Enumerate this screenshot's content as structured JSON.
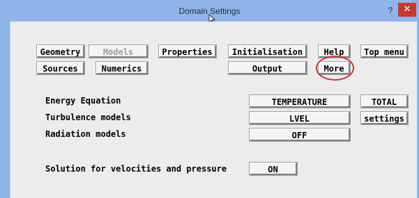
{
  "window": {
    "title": "Domain Settings",
    "help_glyph": "?",
    "close_glyph": "✕"
  },
  "toolbar": {
    "geometry": "Geometry",
    "models": "Models",
    "properties": "Properties",
    "initialisation": "Initialisation",
    "help": "Help",
    "top_menu": "Top menu",
    "sources": "Sources",
    "numerics": "Numerics",
    "output": "Output",
    "more": "More"
  },
  "settings": {
    "energy_label": "Energy Equation",
    "energy_value": "TEMPERATURE",
    "energy_total": "TOTAL",
    "turbulence_label": "Turbulence models",
    "turbulence_value": "LVEL",
    "turbulence_settings": "settings",
    "radiation_label": "Radiation models",
    "radiation_value": "OFF",
    "solution_label": "Solution for velocities and pressure",
    "solution_value": "ON"
  },
  "state": {
    "models_disabled": true,
    "annotation_color": "#c0393f"
  }
}
